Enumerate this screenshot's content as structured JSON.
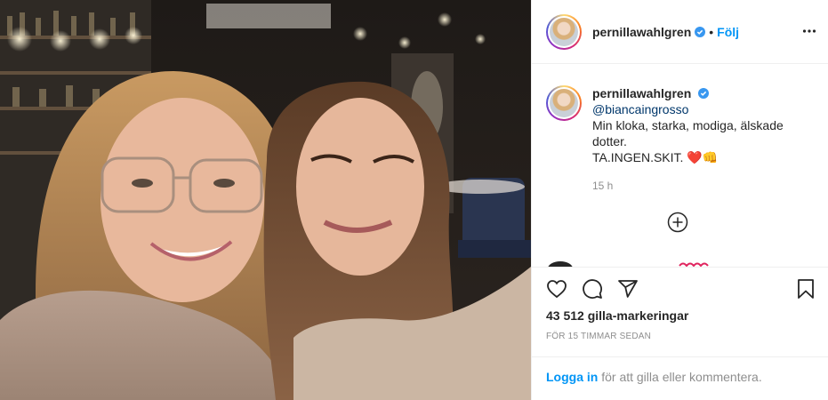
{
  "post": {
    "photo_alt": "",
    "header": {
      "username": "pernillawahlgren",
      "separator": "•",
      "follow_label": "Följ"
    },
    "caption": {
      "username": "pernillawahlgren",
      "mention": "@biancaingrosso",
      "line1": "Min kloka, starka, modiga, älskade",
      "line2": "dotter.",
      "line3": "TA.INGEN.SKIT.",
      "emoji": "❤️👊",
      "time": "15 h"
    },
    "likes": "43 512 gilla-markeringar",
    "ago": "FÖR 15 TIMMAR SEDAN",
    "login": {
      "link": "Logga in",
      "rest": " för att gilla eller kommentera."
    }
  },
  "colors": {
    "link_blue": "#0095f6",
    "mention_blue": "#00376b",
    "text": "#262626",
    "muted": "#8e8e8e",
    "verified": "#3897f0"
  },
  "icons": [
    "verified-icon",
    "more-options-icon",
    "add-comment-icon",
    "heart-icon",
    "comment-icon",
    "share-icon",
    "bookmark-icon"
  ]
}
